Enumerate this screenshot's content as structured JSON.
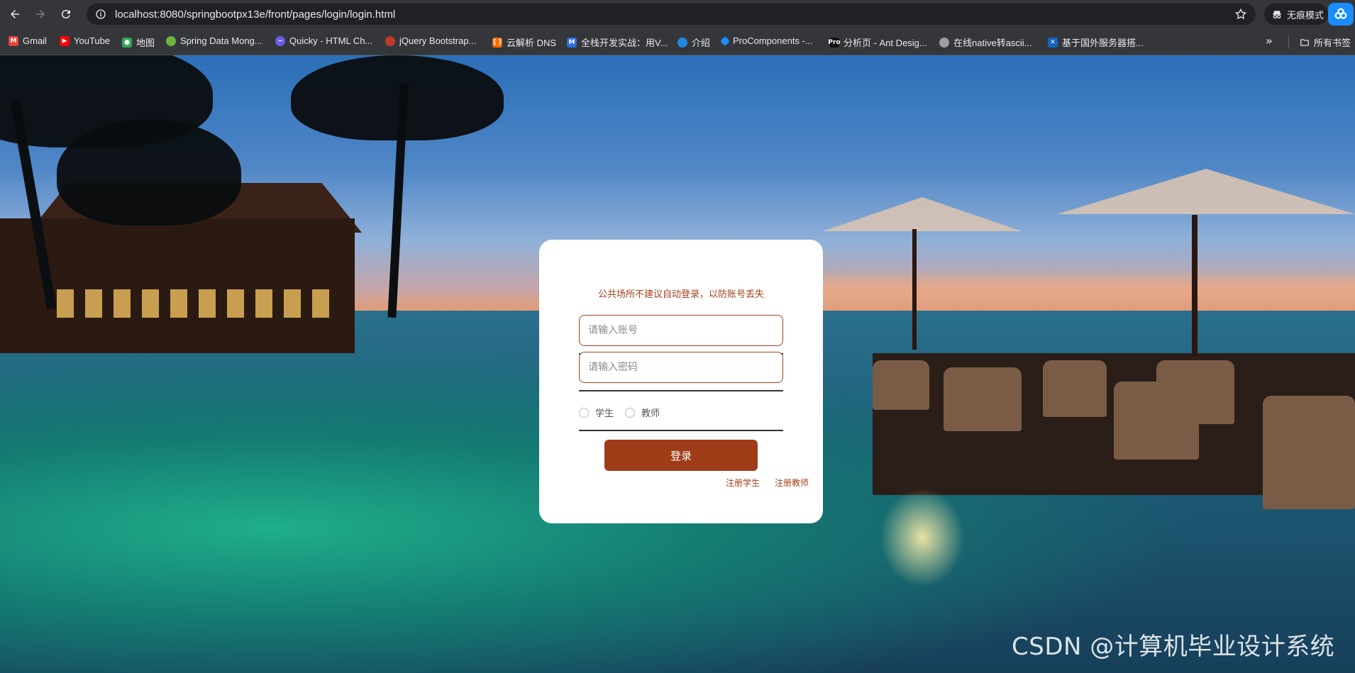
{
  "browser": {
    "url": "localhost:8080/springbootpx13e/front/pages/login/login.html",
    "incognito_label": "无痕模式",
    "bookmarks": [
      {
        "label": "Gmail",
        "icon": "gmail-icon",
        "color": "#ea4335"
      },
      {
        "label": "YouTube",
        "icon": "youtube-icon",
        "color": "#ff0000"
      },
      {
        "label": "地图",
        "icon": "maps-icon",
        "color": "#34a853"
      },
      {
        "label": "Spring Data Mong...",
        "icon": "spring-icon",
        "color": "#6db33f"
      },
      {
        "label": "Quicky - HTML Ch...",
        "icon": "quicky-icon",
        "color": "#6c5ce7"
      },
      {
        "label": "jQuery Bootstrap...",
        "icon": "jquery-icon",
        "color": "#c0392b"
      },
      {
        "label": "云解析 DNS",
        "icon": "aliyun-icon",
        "color": "#ff6a00"
      },
      {
        "label": "全栈开发实战：用V...",
        "icon": "m-icon",
        "color": "#2d6cdf"
      },
      {
        "label": "介绍",
        "icon": "globe-icon",
        "color": "#1e88e5"
      },
      {
        "label": "ProComponents -...",
        "icon": "antd-icon",
        "color": "#1890ff"
      },
      {
        "label": "分析页 - Ant Desig...",
        "icon": "pro-icon",
        "color": "#111111"
      },
      {
        "label": "在线native转ascii...",
        "icon": "web-icon",
        "color": "#9e9e9e"
      },
      {
        "label": "基于国外服务器搭...",
        "icon": "flag-icon",
        "color": "#1565c0"
      }
    ],
    "all_bookmarks_label": "所有书签"
  },
  "login": {
    "tip": "公共场所不建议自动登录，以防账号丢失",
    "account_placeholder": "请输入账号",
    "password_placeholder": "请输入密码",
    "role_student": "学生",
    "role_teacher": "教师",
    "submit_label": "登录",
    "register_student": "注册学生",
    "register_teacher": "注册教师"
  },
  "watermark": "CSDN @计算机毕业设计系统"
}
